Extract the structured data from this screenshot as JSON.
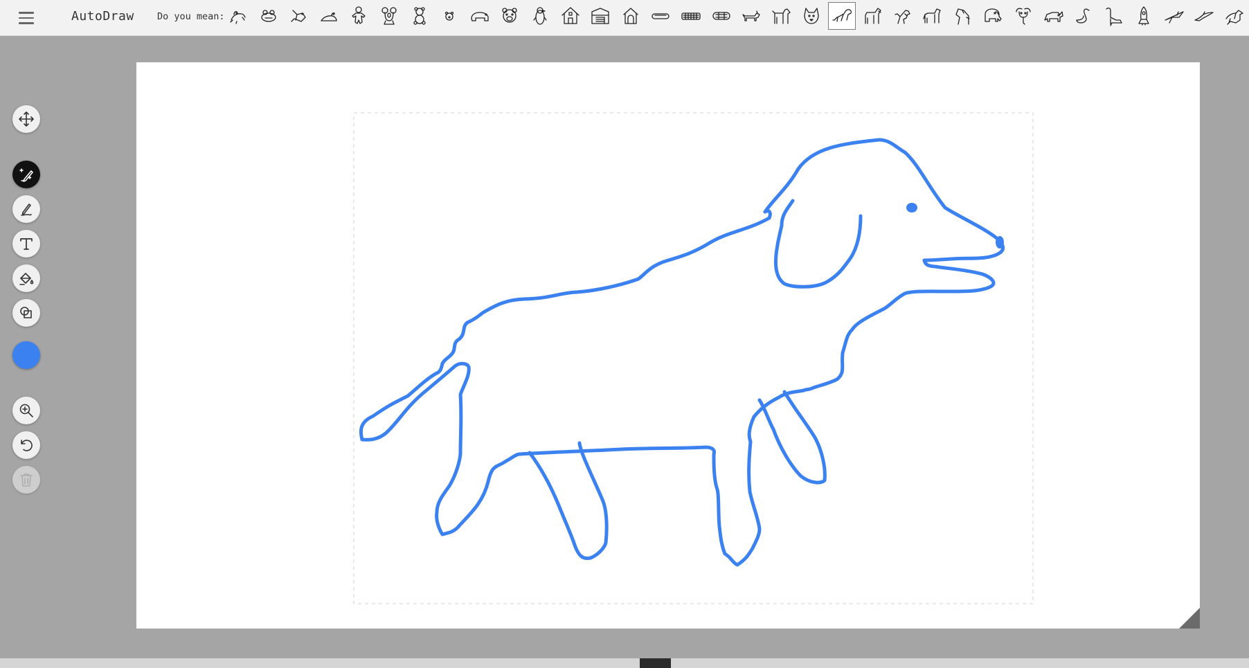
{
  "app": {
    "title": "AutoDraw"
  },
  "suggestions": {
    "label": "Do you mean:",
    "selected_index": 20,
    "items": [
      {
        "icon": "frog-icon"
      },
      {
        "icon": "frog-face-icon"
      },
      {
        "icon": "frog-jumping-icon"
      },
      {
        "icon": "frog-sitting-icon"
      },
      {
        "icon": "gingerbread-man-icon"
      },
      {
        "icon": "koala-icon"
      },
      {
        "icon": "teddy-bear-icon"
      },
      {
        "icon": "polar-bear-face-icon"
      },
      {
        "icon": "bear-icon"
      },
      {
        "icon": "bear-face-icon"
      },
      {
        "icon": "penguin-icon"
      },
      {
        "icon": "house-icon"
      },
      {
        "icon": "barn-icon"
      },
      {
        "icon": "dog-house-icon"
      },
      {
        "icon": "bread-loaf-icon"
      },
      {
        "icon": "hot-dog-icon"
      },
      {
        "icon": "sausage-icon"
      },
      {
        "icon": "dachshund-icon"
      },
      {
        "icon": "dog-standing-icon"
      },
      {
        "icon": "dog-face-icon"
      },
      {
        "icon": "dog-selected-icon"
      },
      {
        "icon": "horse-icon"
      },
      {
        "icon": "horse-rearing-icon"
      },
      {
        "icon": "pony-icon"
      },
      {
        "icon": "horse-head-icon"
      },
      {
        "icon": "elephant-icon"
      },
      {
        "icon": "elephant-face-icon"
      },
      {
        "icon": "rhino-icon"
      },
      {
        "icon": "swan-icon"
      },
      {
        "icon": "dinosaur-icon"
      },
      {
        "icon": "rocket-icon"
      },
      {
        "icon": "airplane-icon"
      },
      {
        "icon": "bird-flying-icon"
      },
      {
        "icon": "dragon-icon"
      }
    ]
  },
  "toolbar": {
    "tools": [
      {
        "name": "move-tool",
        "icon": "move-icon",
        "active": false
      },
      {
        "name": "autodraw-tool",
        "icon": "autodraw-pen-sparkle-icon",
        "active": true
      },
      {
        "name": "draw-tool",
        "icon": "pencil-icon",
        "active": false
      },
      {
        "name": "type-tool",
        "icon": "text-icon",
        "active": false
      },
      {
        "name": "fill-tool",
        "icon": "paint-bucket-icon",
        "active": false
      },
      {
        "name": "shape-tool",
        "icon": "shapes-icon",
        "active": false
      },
      {
        "name": "zoom-tool",
        "icon": "zoom-in-icon",
        "active": false
      },
      {
        "name": "undo-tool",
        "icon": "undo-icon",
        "active": false
      },
      {
        "name": "delete-tool",
        "icon": "trash-icon",
        "active": false,
        "disabled": true
      }
    ],
    "current_color": "#3b82f0"
  },
  "colors": {
    "stroke": "#3b82f0",
    "topbar": "#f2f2f2",
    "workspace": "#a5a5a5",
    "canvas": "#ffffff"
  }
}
